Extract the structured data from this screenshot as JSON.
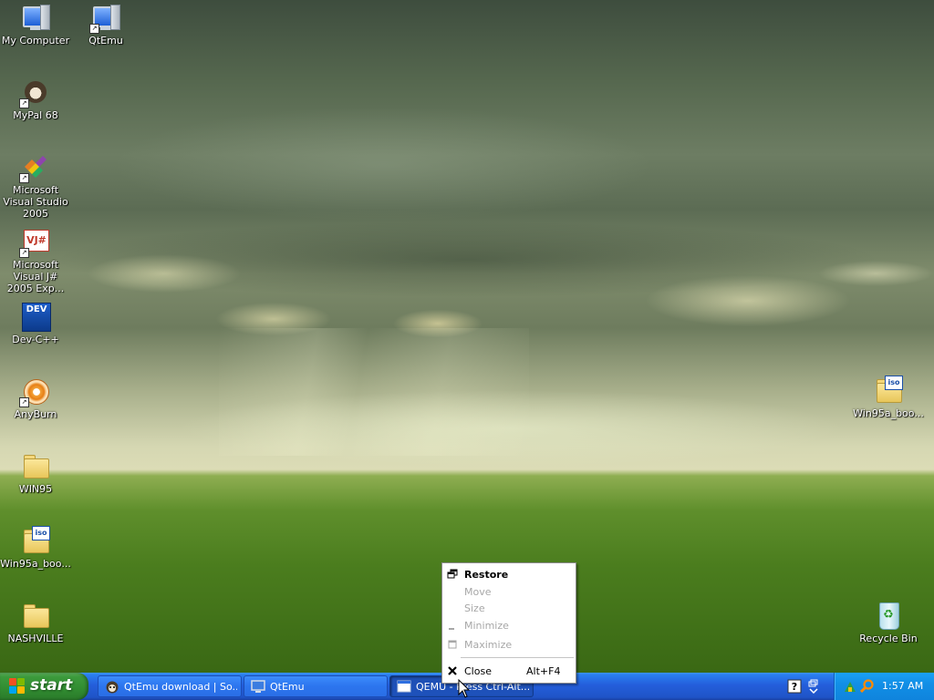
{
  "desktop": {
    "icons": [
      {
        "label": "My Computer"
      },
      {
        "label": "QtEmu"
      },
      {
        "label": "MyPal 68"
      },
      {
        "label": "Microsoft Visual Studio 2005"
      },
      {
        "label": "Microsoft Visual J# 2005 Exp..."
      },
      {
        "label": "Dev-C++"
      },
      {
        "label": "AnyBurn"
      },
      {
        "label": "WIN95"
      },
      {
        "label": "Win95a_boo..."
      },
      {
        "label": "NASHVILLE"
      },
      {
        "label": "Win95a_boo..."
      },
      {
        "label": "Recycle Bin"
      }
    ],
    "icon_texts": {
      "vj": "VJ#",
      "dev": "DEV",
      "iso": "iso"
    }
  },
  "context_menu": {
    "items": [
      {
        "label": "Restore",
        "enabled": true,
        "bold": true,
        "icon": "restore-icon"
      },
      {
        "label": "Move",
        "enabled": false
      },
      {
        "label": "Size",
        "enabled": false
      },
      {
        "label": "Minimize",
        "enabled": false,
        "icon": "minimize-icon"
      },
      {
        "label": "Maximize",
        "enabled": false,
        "icon": "maximize-icon"
      },
      {
        "label": "Close",
        "enabled": true,
        "shortcut": "Alt+F4",
        "icon": "close-x-icon"
      }
    ]
  },
  "taskbar": {
    "start_label": "start",
    "tasks": [
      {
        "label": "QtEmu download | So...",
        "icon": "browser-raccoon-icon",
        "active": false
      },
      {
        "label": "QtEmu",
        "icon": "qtemu-monitor-icon",
        "active": false
      },
      {
        "label": "QEMU - Press Ctrl-Alt...",
        "icon": "window-icon",
        "active": true
      }
    ],
    "clock": "1:57 AM"
  },
  "colors": {
    "taskbar_blue": "#245edb",
    "start_green": "#318c31",
    "tray_blue": "#128fe6",
    "menu_disabled": "#a7a7a7"
  }
}
